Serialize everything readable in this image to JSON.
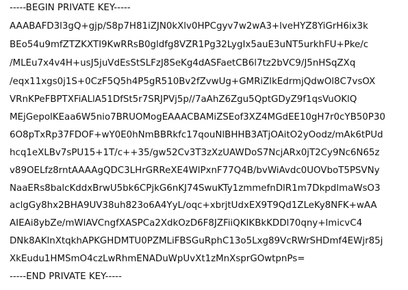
{
  "document": {
    "header": "-----BEGIN PRIVATE KEY-----",
    "body_lines": [
      "AAABAFD3l3gQ+gjp/S8p7H81iZJN0kXlv0HPCgyv7w2wA3+lveHYZ8YiGrH6ix3k",
      "BEo54u9mfZTZKXTI9KwRRsB0gldfg8VZR1Pg32LygIx5auE3uNT5urkhFU+Pke/c",
      "/MLEu7x4v4H+usJ5juVdEsStSLFzJ8SeKg4dASFaetCB6l7tz2bVC9/J5nHSqZXq",
      "/eqx11xgs0j1S+0CzF5Q5h4P5gR510Bv2fZvwUg+GMRiZlkEdrmjQdwOl8C7vsOX",
      "VRnKPeFBPTXFiALlA51DfSt5r7SRJPVj5p//7aAhZ6Zgu5QptGDyZ9f1qsVuOKlQ",
      "MEjGepolKEaa6W5nio7BRUOMogEAAACBAMiZSEof3XZ4MGdEE10gH7r0cYB50P30",
      "6O8pTxRp37FDOF+wY0E0hNmBBRkfc17qouNlBHHB3ATjOAitO2yOodz/mAk6tPUd",
      "hcq1eXLBv7sPU15+1T/c++35/gw52Cv3T3zXzUAWDoS7NcjARx0jT2Cy9Nc6N65z",
      "v89OELfz8rntAAAAgQDC3LHrGRReXE4WlPxnF77Q4B/bvWiAvdc0UOVboT5PSVNy",
      "NaaERs8balcKddxBrwU5bk6CPjkG6nKJ74SwuKTy1zmmefnDlR1m7DkpdlmaWsO3",
      "aclgGy8hx2BHA9UV38uh823o6A4YyL/oqc+xbrjtUdxEX9T9Qd1ZLeKy8NFK+wAA",
      "AIEAi8ybZe/mWlAVCngfXASPCa2XdkOzD6F8JZFiiQKIKBkKDDl70qny+lmicvC4",
      "DNk8AKlnXtqkhAPKGHDMTU0PZMLiFBSGuRphC13o5Lxg89VcRWrSHDmf4EWjr85j",
      "XkEudu1HMSmO4czLwRhmENADuWpUvXt1zMnXsprGOwtpnPs="
    ],
    "footer": "-----END PRIVATE KEY-----"
  }
}
